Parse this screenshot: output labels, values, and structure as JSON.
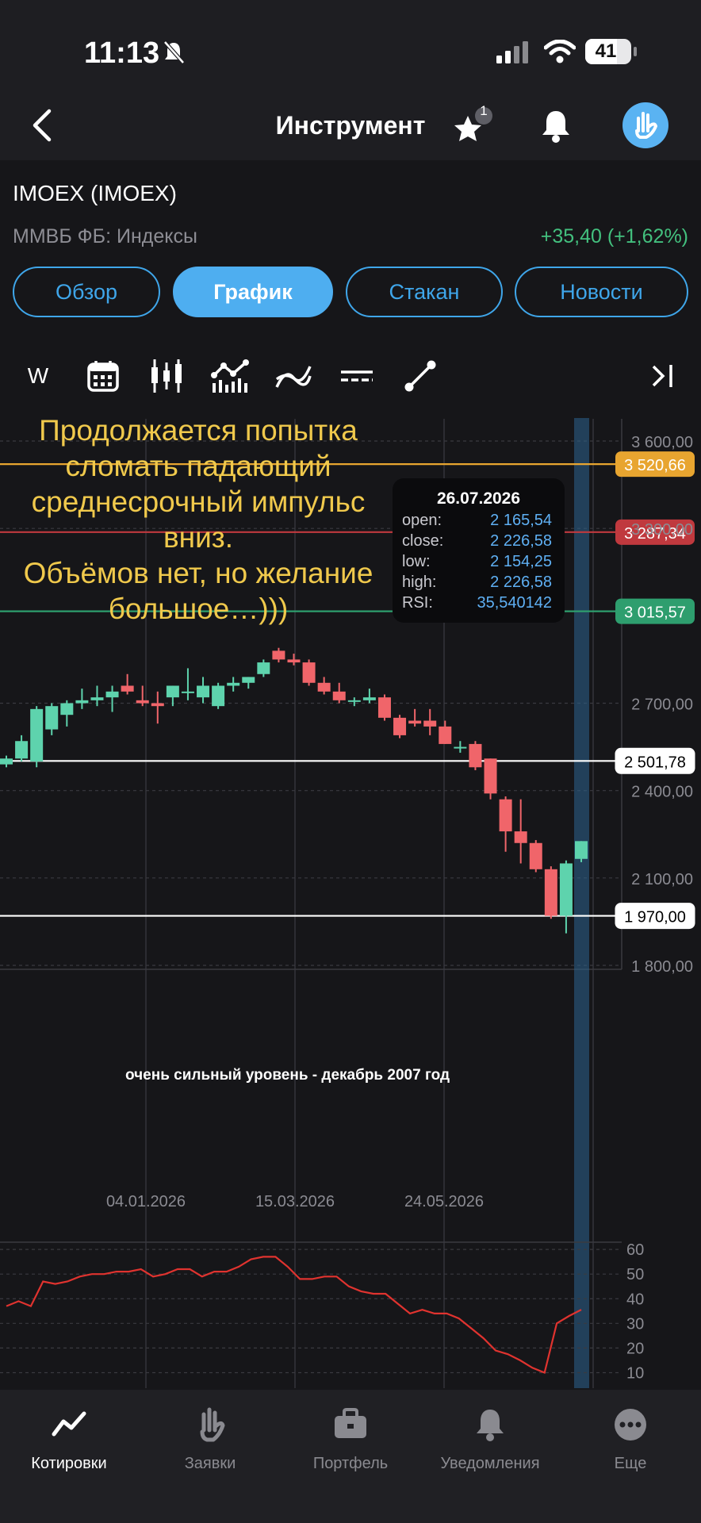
{
  "status": {
    "time": "11:13",
    "battery": "41"
  },
  "header": {
    "title": "Инструмент",
    "favorites_badge": "1"
  },
  "instrument": {
    "name": "IMOEX (IMOEX)",
    "exchange": "ММВБ ФБ: Индексы",
    "change": "+35,40 (+1,62%)"
  },
  "tabs": [
    {
      "label": "Обзор",
      "active": false
    },
    {
      "label": "График",
      "active": true
    },
    {
      "label": "Стакан",
      "active": false
    },
    {
      "label": "Новости",
      "active": false
    }
  ],
  "toolbar": {
    "timeframe": "W"
  },
  "annotation": {
    "lines": [
      "Продолжается попытка",
      "сломать падающий",
      "среднесрочный импульс",
      "вниз.",
      "Объёмов нет, но желание",
      "большое…)))"
    ]
  },
  "level_note": "очень сильный уровень - декабрь 2007 год",
  "tooltip": {
    "date": "26.07.2026",
    "rows": [
      {
        "label": "open:",
        "value": "2 165,54"
      },
      {
        "label": "close:",
        "value": "2 226,58"
      },
      {
        "label": "low:",
        "value": "2 154,25"
      },
      {
        "label": "high:",
        "value": "2 226,58"
      },
      {
        "label": "RSI:",
        "value": "35,540142"
      }
    ]
  },
  "colors": {
    "up": "#5ed3ad",
    "down": "#f0656a",
    "accent": "#4eaef0",
    "annotation": "#f0c94c"
  },
  "chart_data": {
    "type": "candlestick",
    "price_axis": {
      "ticks": [
        "3 600,00",
        "3 300,00",
        "2 700,00",
        "2 400,00",
        "2 100,00",
        "1 800,00"
      ],
      "tick_values": [
        3600,
        3300,
        2700,
        2400,
        2100,
        1800
      ],
      "ylim": [
        1740,
        3660
      ]
    },
    "x_labels": [
      "04.01.2026",
      "15.03.2026",
      "24.05.2026"
    ],
    "horizontal_levels": [
      {
        "label": "3 520,66",
        "value": 3520.66,
        "color": "#e8a530"
      },
      {
        "label": "3 287,34",
        "value": 3287.34,
        "color": "#c0393e"
      },
      {
        "label": "3 015,57",
        "value": 3015.57,
        "color": "#2e9e6e"
      },
      {
        "label": "2 501,78",
        "value": 2501.78,
        "color": "#ffffff"
      },
      {
        "label": "1 970,00",
        "value": 1970.0,
        "color": "#ffffff"
      }
    ],
    "candles": [
      {
        "o": 2490,
        "h": 2520,
        "l": 2480,
        "c": 2510
      },
      {
        "o": 2510,
        "h": 2590,
        "l": 2500,
        "c": 2570
      },
      {
        "o": 2500,
        "h": 2690,
        "l": 2480,
        "c": 2680
      },
      {
        "o": 2610,
        "h": 2700,
        "l": 2590,
        "c": 2690
      },
      {
        "o": 2660,
        "h": 2710,
        "l": 2620,
        "c": 2700
      },
      {
        "o": 2700,
        "h": 2750,
        "l": 2680,
        "c": 2710
      },
      {
        "o": 2710,
        "h": 2760,
        "l": 2690,
        "c": 2720
      },
      {
        "o": 2720,
        "h": 2760,
        "l": 2670,
        "c": 2740
      },
      {
        "o": 2760,
        "h": 2800,
        "l": 2730,
        "c": 2740
      },
      {
        "o": 2710,
        "h": 2760,
        "l": 2690,
        "c": 2700
      },
      {
        "o": 2700,
        "h": 2740,
        "l": 2630,
        "c": 2690
      },
      {
        "o": 2720,
        "h": 2760,
        "l": 2690,
        "c": 2760
      },
      {
        "o": 2740,
        "h": 2820,
        "l": 2710,
        "c": 2740
      },
      {
        "o": 2720,
        "h": 2790,
        "l": 2700,
        "c": 2760
      },
      {
        "o": 2690,
        "h": 2770,
        "l": 2680,
        "c": 2760
      },
      {
        "o": 2760,
        "h": 2790,
        "l": 2740,
        "c": 2770
      },
      {
        "o": 2770,
        "h": 2790,
        "l": 2750,
        "c": 2790
      },
      {
        "o": 2800,
        "h": 2850,
        "l": 2790,
        "c": 2840
      },
      {
        "o": 2880,
        "h": 2890,
        "l": 2840,
        "c": 2850
      },
      {
        "o": 2850,
        "h": 2870,
        "l": 2830,
        "c": 2840
      },
      {
        "o": 2840,
        "h": 2850,
        "l": 2760,
        "c": 2770
      },
      {
        "o": 2770,
        "h": 2790,
        "l": 2730,
        "c": 2740
      },
      {
        "o": 2740,
        "h": 2770,
        "l": 2700,
        "c": 2710
      },
      {
        "o": 2710,
        "h": 2720,
        "l": 2690,
        "c": 2710
      },
      {
        "o": 2710,
        "h": 2750,
        "l": 2700,
        "c": 2720
      },
      {
        "o": 2720,
        "h": 2730,
        "l": 2640,
        "c": 2650
      },
      {
        "o": 2650,
        "h": 2660,
        "l": 2580,
        "c": 2590
      },
      {
        "o": 2640,
        "h": 2680,
        "l": 2620,
        "c": 2630
      },
      {
        "o": 2640,
        "h": 2680,
        "l": 2590,
        "c": 2620
      },
      {
        "o": 2620,
        "h": 2640,
        "l": 2560,
        "c": 2560
      },
      {
        "o": 2550,
        "h": 2570,
        "l": 2530,
        "c": 2550
      },
      {
        "o": 2560,
        "h": 2570,
        "l": 2470,
        "c": 2480
      },
      {
        "o": 2510,
        "h": 2510,
        "l": 2370,
        "c": 2390
      },
      {
        "o": 2370,
        "h": 2380,
        "l": 2190,
        "c": 2260
      },
      {
        "o": 2260,
        "h": 2370,
        "l": 2150,
        "c": 2220
      },
      {
        "o": 2220,
        "h": 2230,
        "l": 2120,
        "c": 2130
      },
      {
        "o": 2130,
        "h": 2140,
        "l": 1960,
        "c": 1970
      },
      {
        "o": 1970,
        "h": 2160,
        "l": 1910,
        "c": 2150
      },
      {
        "o": 2165.54,
        "h": 2226.58,
        "l": 2154.25,
        "c": 2226.58
      }
    ],
    "rsi": {
      "ticks": [
        "60",
        "50",
        "40",
        "30",
        "20",
        "10"
      ],
      "tick_values": [
        60,
        50,
        40,
        30,
        20,
        10
      ],
      "ylim": [
        5,
        61
      ],
      "values": [
        37,
        39,
        37,
        47,
        46,
        47,
        49,
        50,
        50,
        51,
        51,
        52,
        49,
        50,
        52,
        52,
        49,
        51,
        51,
        53,
        56,
        57,
        57,
        53,
        48,
        48,
        49,
        49,
        45,
        43,
        42,
        42,
        38,
        34,
        35.5,
        34,
        34,
        32,
        28,
        24,
        19,
        17.5,
        15,
        12,
        10,
        30,
        33,
        35.54
      ]
    }
  },
  "nav": [
    {
      "label": "Котировки",
      "active": true
    },
    {
      "label": "Заявки",
      "active": false
    },
    {
      "label": "Портфель",
      "active": false
    },
    {
      "label": "Уведомления",
      "active": false
    },
    {
      "label": "Еще",
      "active": false
    }
  ]
}
